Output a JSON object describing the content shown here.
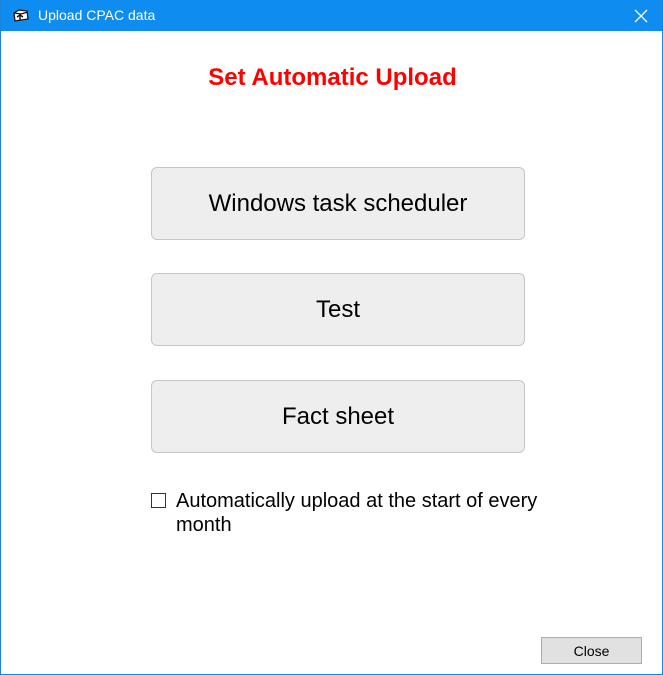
{
  "window": {
    "title": "Upload CPAC data",
    "title_icon": "upload-folder-icon",
    "close_icon": "close-icon"
  },
  "heading": "Set Automatic Upload",
  "buttons": {
    "scheduler_label": "Windows task scheduler",
    "test_label": "Test",
    "fact_sheet_label": "Fact sheet",
    "close_label": "Close"
  },
  "checkbox": {
    "label": "Automatically upload at the start of every month",
    "checked": false
  },
  "colors": {
    "titlebar": "#0f8cf0",
    "heading": "#ff0000",
    "button_bg": "#eeeeee"
  }
}
